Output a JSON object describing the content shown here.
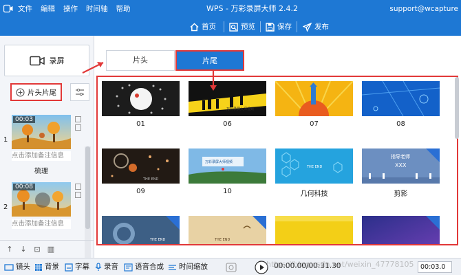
{
  "titlebar": {
    "menu": [
      "文件",
      "编辑",
      "操作",
      "时间轴",
      "帮助"
    ],
    "title": "WPS - 万彩录屏大师 2.4.2",
    "user": "support@wcapture"
  },
  "toolbar": {
    "home": "首页",
    "preview": "预览",
    "save": "保存",
    "publish": "发布"
  },
  "left": {
    "record_label": "录屏",
    "headtail_label": "片头片尾",
    "clips": [
      {
        "number": "1",
        "time": "00:03",
        "note": "点击添加备注信息",
        "label": "梳理"
      },
      {
        "number": "2",
        "time": "00:08",
        "note": "点击添加备注信息",
        "label": ""
      }
    ]
  },
  "tabs": [
    {
      "label": "片头",
      "active": false
    },
    {
      "label": "片尾",
      "active": true
    }
  ],
  "templates": [
    {
      "name": "01",
      "badge": ""
    },
    {
      "name": "06",
      "badge": ""
    },
    {
      "name": "07",
      "badge": ""
    },
    {
      "name": "08",
      "badge": ""
    },
    {
      "name": "09",
      "badge": ""
    },
    {
      "name": "10",
      "badge": ""
    },
    {
      "name": "几何科技",
      "badge": ""
    },
    {
      "name": "剪影",
      "badge": "VIP"
    },
    {
      "name": "",
      "badge": "VIP"
    },
    {
      "name": "",
      "badge": "VIP"
    },
    {
      "name": "",
      "badge": ""
    },
    {
      "name": "",
      "badge": "VIP"
    }
  ],
  "thumb_text": {
    "t06": "万彩录屏大师视频",
    "t09": "THE END",
    "t10": "万彩录屏大师视频",
    "t_geo": "THE END",
    "t_shadow_title": "指导老师",
    "t_shadow_name": "XXX",
    "r3a": "THE END",
    "r3b": "THE END"
  },
  "bottombar": {
    "lens": "镜头",
    "background": "背景",
    "subtitle": "字幕",
    "record_audio": "录音",
    "tts": "语音合成",
    "time_zoom": "时间缩放",
    "time_display": "00:00.00/00:31.30",
    "time_input": "00:03.0"
  },
  "watermark": "https://blog.csdn.net/weixin_47778105"
}
